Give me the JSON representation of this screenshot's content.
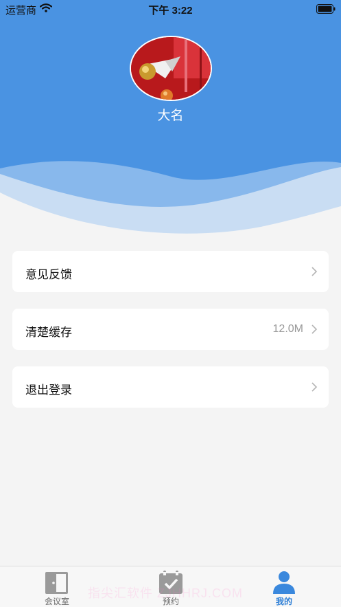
{
  "status_bar": {
    "carrier": "运营商",
    "time": "下午 3:22"
  },
  "profile": {
    "name": "大名"
  },
  "menu": [
    {
      "label": "意见反馈",
      "value": ""
    },
    {
      "label": "清楚缓存",
      "value": "12.0M"
    },
    {
      "label": "退出登录",
      "value": ""
    }
  ],
  "tabs": [
    {
      "label": "会议室",
      "icon": "door-icon",
      "active": false
    },
    {
      "label": "预约",
      "icon": "calendar-check-icon",
      "active": false
    },
    {
      "label": "我的",
      "icon": "user-icon",
      "active": true
    }
  ],
  "watermark": "指尖汇软件 ZJHHRJ.COM",
  "colors": {
    "header": "#4a93e2",
    "accent": "#2e7fd6",
    "background": "#f4f4f4"
  }
}
